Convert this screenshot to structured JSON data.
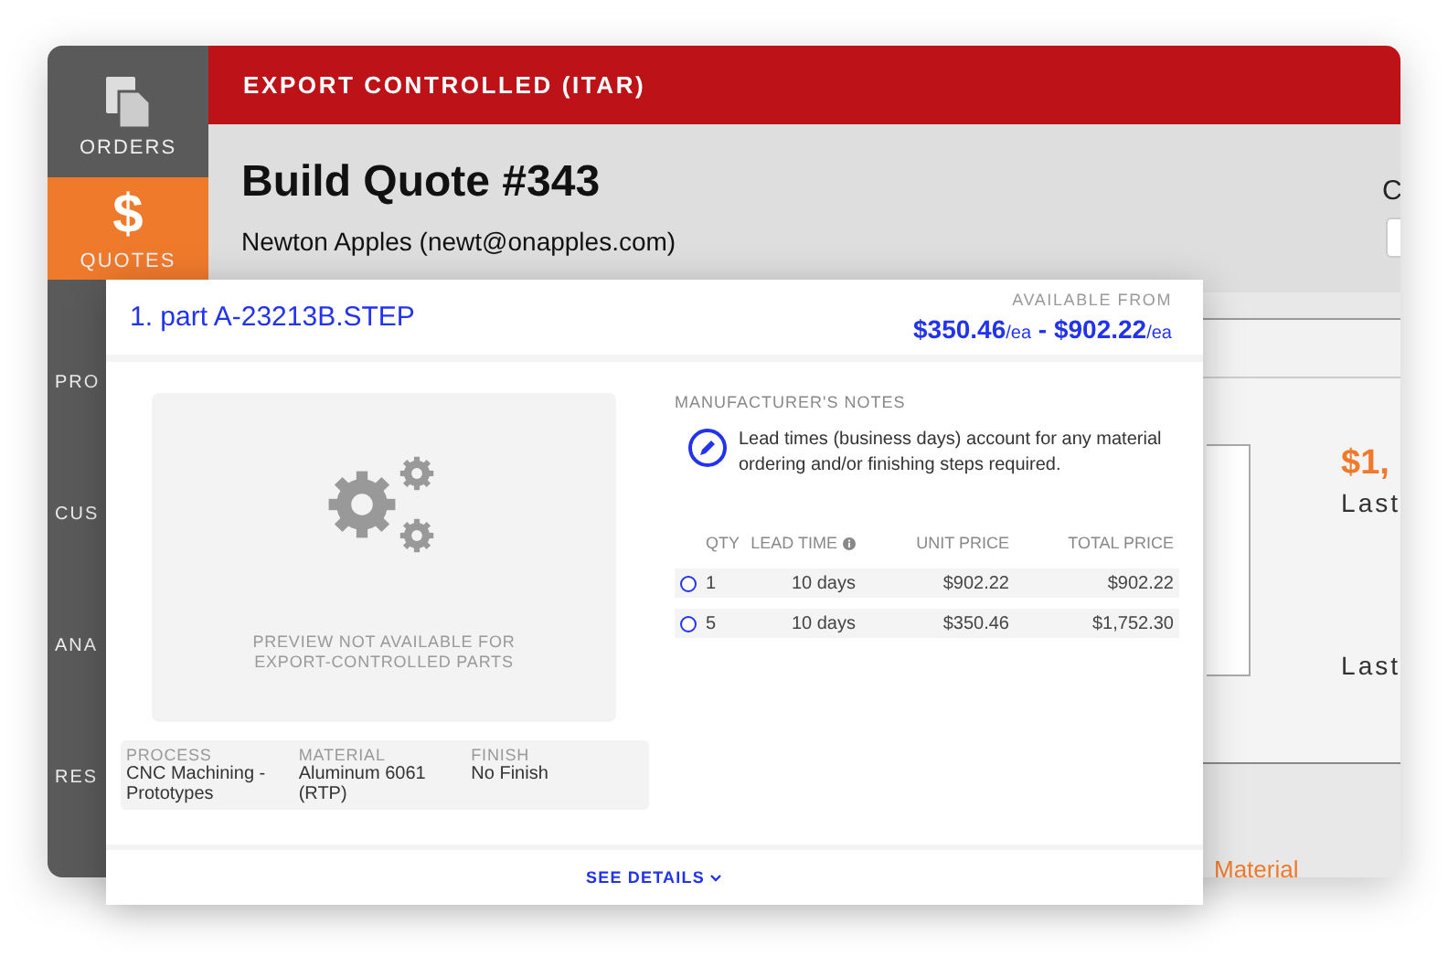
{
  "sidebar": {
    "items": [
      {
        "kind": "documents",
        "label": "ORDERS",
        "selected": false
      },
      {
        "kind": "glyph",
        "label": "QUOTES",
        "glyph": "$",
        "selected": true
      },
      {
        "kind": "cut",
        "label": "PRO",
        "selected": false
      },
      {
        "kind": "cut",
        "label": "CUS",
        "selected": false
      },
      {
        "kind": "cut",
        "label": "ANA",
        "selected": false
      },
      {
        "kind": "cut",
        "label": "RES",
        "selected": false
      }
    ]
  },
  "banner": "EXPORT CONTROLLED (ITAR)",
  "quote": {
    "title": "Build Quote #343",
    "customer_name": "Newton Apples",
    "customer_email": "(newt@onapples.com)"
  },
  "background": {
    "header_label": "C",
    "price": "$1,",
    "labels": [
      "Last",
      "Last"
    ],
    "link": "Material"
  },
  "card": {
    "title": "1. part A-23213B.STEP",
    "available_label": "AVAILABLE FROM",
    "price_low": "$350.46",
    "price_high": "$902.22",
    "unit_low": "/ea",
    "unit_high": "/ea",
    "separator": "-",
    "preview_text": "PREVIEW NOT AVAILABLE FOR EXPORT-CONTROLLED PARTS",
    "specs": [
      {
        "label": "PROCESS",
        "value": "CNC Machining - Prototypes"
      },
      {
        "label": "MATERIAL",
        "value": "Aluminum 6061 (RTP)"
      },
      {
        "label": "FINISH",
        "value": "No Finish"
      }
    ],
    "notes_heading": "MANUFACTURER'S NOTES",
    "note": "Lead times (business days) account for any material ordering and/or finishing steps required.",
    "table": {
      "columns": [
        "QTY",
        "LEAD TIME",
        "UNIT PRICE",
        "TOTAL PRICE"
      ],
      "rows": [
        {
          "qty": "1",
          "lead_time": "10 days",
          "unit_price": "$902.22",
          "total_price": "$902.22",
          "selected": false
        },
        {
          "qty": "5",
          "lead_time": "10 days",
          "unit_price": "$350.46",
          "total_price": "$1,752.30",
          "selected": false
        }
      ]
    },
    "see_details": "SEE DETAILS"
  }
}
